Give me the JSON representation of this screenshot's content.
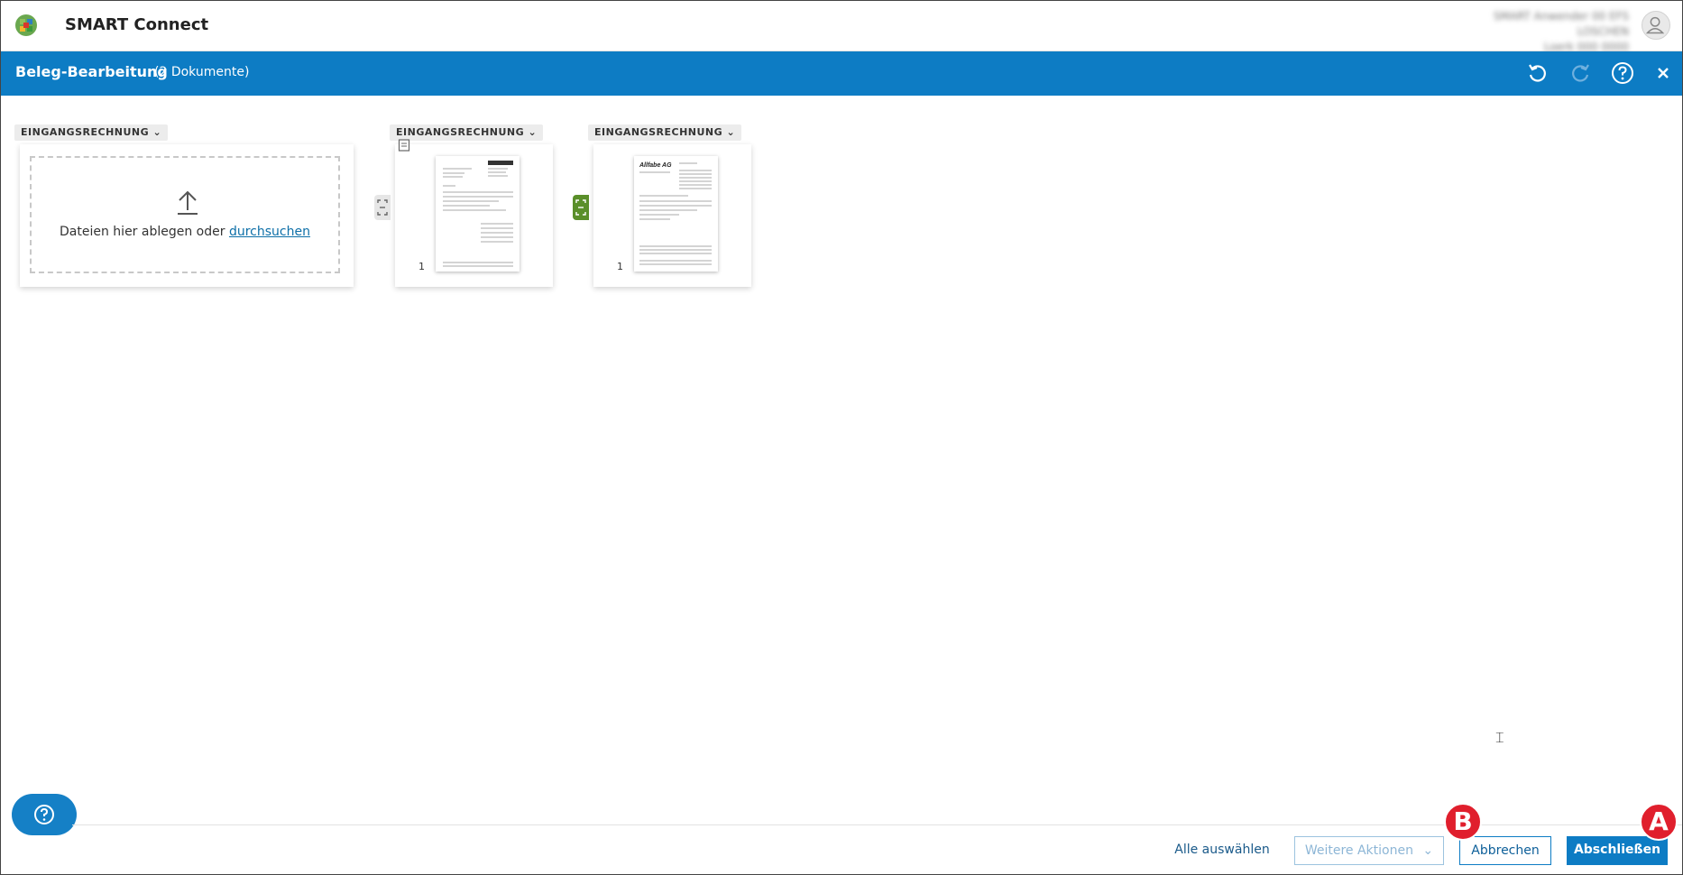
{
  "app": {
    "title": "SMART Connect",
    "user_line1": "SMART Anwender 00 EFS LOSCHEN",
    "user_line2": "Loerk 000 0000"
  },
  "header": {
    "title": "Beleg-Bearbeitung",
    "subtitle": "(2 Dokumente)",
    "icons": [
      "undo-icon",
      "redo-icon",
      "help-icon",
      "close-icon"
    ]
  },
  "groups": [
    {
      "type_label": "EINGANGSRECHNUNG",
      "dropzone_text": "Dateien hier ablegen oder ",
      "dropzone_link": "durchsuchen"
    },
    {
      "type_label": "EINGANGSRECHNUNG",
      "page_number": "1"
    },
    {
      "type_label": "EINGANGSRECHNUNG",
      "page_number": "1",
      "thumb_logo": "Allfabe AG"
    }
  ],
  "footer": {
    "select_all": "Alle auswählen",
    "more_actions": "Weitere Aktionen",
    "cancel": "Abbrechen",
    "finish": "Abschließen"
  },
  "markers": {
    "a": "A",
    "b": "B"
  },
  "colors": {
    "primary": "#0d7cc4",
    "split_active": "#5a8f2a",
    "marker": "#e01f2d"
  }
}
